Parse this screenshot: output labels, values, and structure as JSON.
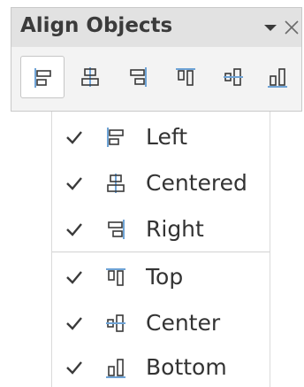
{
  "panel": {
    "title": "Align Objects",
    "menu_icon": "dropdown-arrow-icon",
    "close_icon": "close-icon"
  },
  "toolbar": {
    "buttons": [
      {
        "icon": "align-left-icon",
        "active": true
      },
      {
        "icon": "align-centered-icon",
        "active": false
      },
      {
        "icon": "align-right-icon",
        "active": false
      },
      {
        "icon": "align-top-icon",
        "active": false
      },
      {
        "icon": "align-center-icon",
        "active": false
      },
      {
        "icon": "align-bottom-icon",
        "active": false
      }
    ]
  },
  "menu": {
    "groups": [
      {
        "items": [
          {
            "label": "Left",
            "checked": true,
            "icon": "align-left-icon"
          },
          {
            "label": "Centered",
            "checked": true,
            "icon": "align-centered-icon"
          },
          {
            "label": "Right",
            "checked": true,
            "icon": "align-right-icon"
          }
        ]
      },
      {
        "items": [
          {
            "label": "Top",
            "checked": true,
            "icon": "align-top-icon"
          },
          {
            "label": "Center",
            "checked": true,
            "icon": "align-center-icon"
          },
          {
            "label": "Bottom",
            "checked": true,
            "icon": "align-bottom-icon"
          }
        ]
      }
    ]
  },
  "colors": {
    "icon_outline": "#3a3a3a",
    "icon_guide": "#6ea3d6",
    "active_background": "#ffffff",
    "titlebar": "#e2e2e2"
  }
}
